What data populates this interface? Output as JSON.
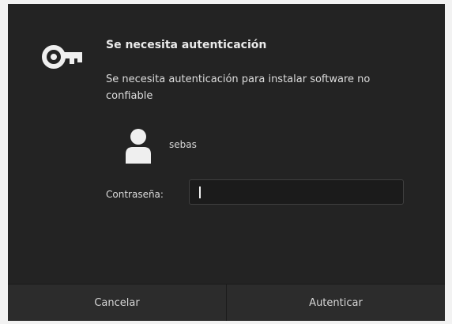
{
  "dialog": {
    "icon": "key-icon",
    "title": "Se necesita autenticación",
    "message": "Se necesita autenticación para instalar software no confiable",
    "user": {
      "avatar_icon": "user-avatar-icon",
      "name": "sebas"
    },
    "password": {
      "label": "Contraseña:",
      "value": ""
    },
    "buttons": {
      "cancel": "Cancelar",
      "authenticate": "Autenticar"
    }
  },
  "colors": {
    "dialog_background": "#232323",
    "footer_background": "#2c2c2c",
    "text": "#e8e8e8"
  }
}
